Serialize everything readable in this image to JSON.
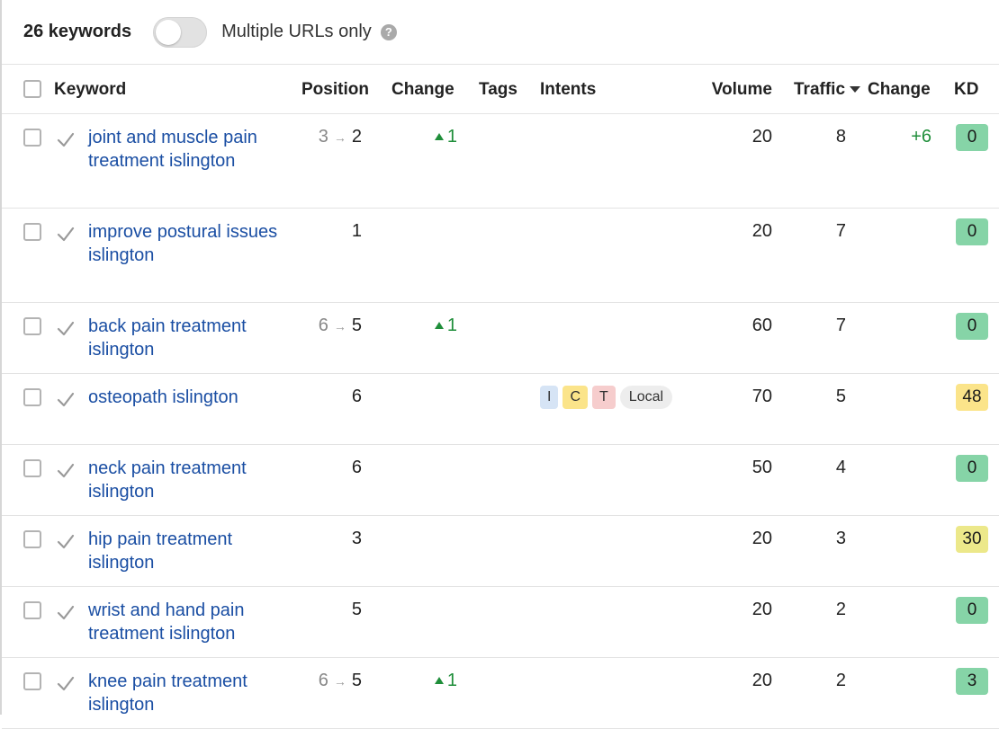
{
  "header": {
    "keyword_count": "26 keywords",
    "toggle_label": "Multiple URLs only",
    "toggle_on": false,
    "help_glyph": "?"
  },
  "columns": {
    "keyword": "Keyword",
    "position": "Position",
    "change": "Change",
    "tags": "Tags",
    "intents": "Intents",
    "volume": "Volume",
    "traffic": "Traffic",
    "traffic_change": "Change",
    "kd": "KD"
  },
  "colors": {
    "link": "#1a4ea3",
    "positive": "#1f8e3a",
    "kd_green": "#86d4a7",
    "kd_yellow": "#fbe48a",
    "kd_lime": "#ece88a"
  },
  "rows": [
    {
      "keyword": "joint and muscle pain treatment islington",
      "pos_prev": "3",
      "position": "2",
      "change": "1",
      "intents": [],
      "volume": "20",
      "traffic": "8",
      "traffic_change": "+6",
      "kd": "0",
      "kd_color": "#86d4a7"
    },
    {
      "keyword": "improve postural issues islington",
      "pos_prev": "",
      "position": "1",
      "change": "",
      "intents": [],
      "volume": "20",
      "traffic": "7",
      "traffic_change": "",
      "kd": "0",
      "kd_color": "#86d4a7"
    },
    {
      "keyword": "back pain treatment islington",
      "pos_prev": "6",
      "position": "5",
      "change": "1",
      "intents": [],
      "volume": "60",
      "traffic": "7",
      "traffic_change": "",
      "kd": "0",
      "kd_color": "#86d4a7"
    },
    {
      "keyword": "osteopath islington",
      "pos_prev": "",
      "position": "6",
      "change": "",
      "intents": [
        "I",
        "C",
        "T",
        "Local"
      ],
      "volume": "70",
      "traffic": "5",
      "traffic_change": "",
      "kd": "48",
      "kd_color": "#fbe48a"
    },
    {
      "keyword": "neck pain treatment islington",
      "pos_prev": "",
      "position": "6",
      "change": "",
      "intents": [],
      "volume": "50",
      "traffic": "4",
      "traffic_change": "",
      "kd": "0",
      "kd_color": "#86d4a7"
    },
    {
      "keyword": "hip pain treatment islington",
      "pos_prev": "",
      "position": "3",
      "change": "",
      "intents": [],
      "volume": "20",
      "traffic": "3",
      "traffic_change": "",
      "kd": "30",
      "kd_color": "#ece88a"
    },
    {
      "keyword": "wrist and hand pain treatment islington",
      "pos_prev": "",
      "position": "5",
      "change": "",
      "intents": [],
      "volume": "20",
      "traffic": "2",
      "traffic_change": "",
      "kd": "0",
      "kd_color": "#86d4a7"
    },
    {
      "keyword": "knee pain treatment islington",
      "pos_prev": "6",
      "position": "5",
      "change": "1",
      "intents": [],
      "volume": "20",
      "traffic": "2",
      "traffic_change": "",
      "kd": "3",
      "kd_color": "#86d4a7"
    }
  ]
}
